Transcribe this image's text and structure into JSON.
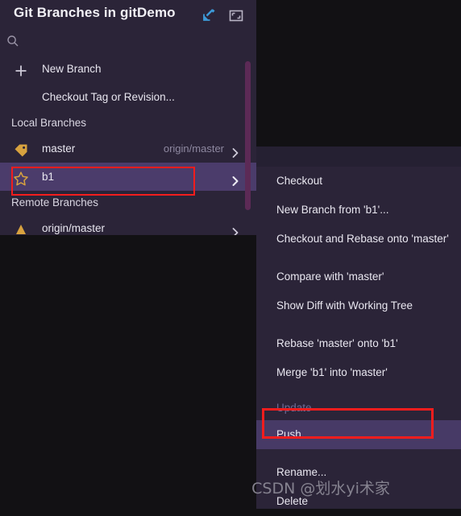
{
  "window": {
    "title": "Git Branches in gitDemo",
    "icons": [
      {
        "name": "open-in-tool-window-icon",
        "label": "Open in Tool Window"
      },
      {
        "name": "restore-window-icon",
        "label": "Restore Window"
      }
    ]
  },
  "search": {
    "value": "",
    "placeholder": "",
    "icon": "search-icon"
  },
  "branch_list": {
    "actions": [
      {
        "label": "New Branch",
        "icon": "plus-icon"
      },
      {
        "label": "Checkout Tag or Revision...",
        "icon": "none"
      }
    ],
    "sections": [
      {
        "header": "Local Branches",
        "rows": [
          {
            "label": "master",
            "icon": "tag-icon",
            "tracking": "origin/master",
            "chevron": "chevron-right-icon",
            "selected": false,
            "annotated": false
          },
          {
            "label": "b1",
            "icon": "star-icon",
            "tracking": "",
            "chevron": "chevron-right-icon",
            "selected": true,
            "annotated": true
          }
        ]
      },
      {
        "header": "Remote Branches",
        "rows": [
          {
            "label": "origin/master",
            "icon": "remote-branch-icon",
            "tracking": "",
            "chevron": "chevron-right-icon",
            "selected": false,
            "annotated": false
          }
        ]
      }
    ]
  },
  "context_menu": {
    "items": [
      {
        "label": "Checkout",
        "type": "item",
        "gap": false,
        "highlighted": false
      },
      {
        "label": "New Branch from 'b1'...",
        "type": "item",
        "gap": false,
        "highlighted": false
      },
      {
        "label": "Checkout and Rebase onto 'master'",
        "type": "item",
        "gap": false,
        "highlighted": false
      },
      {
        "label": "Compare with 'master'",
        "type": "item",
        "gap": true,
        "highlighted": false
      },
      {
        "label": "Show Diff with Working Tree",
        "type": "item",
        "gap": false,
        "highlighted": false
      },
      {
        "label": "Rebase 'master' onto 'b1'",
        "type": "item",
        "gap": true,
        "highlighted": false
      },
      {
        "label": "Merge 'b1' into 'master'",
        "type": "item",
        "gap": false,
        "highlighted": false
      },
      {
        "label": "Update",
        "type": "section-label",
        "gap": true,
        "highlighted": false
      },
      {
        "label": "Push...",
        "type": "item",
        "gap": false,
        "highlighted": true
      },
      {
        "label": "Rename...",
        "type": "item",
        "gap": true,
        "highlighted": false
      },
      {
        "label": "Delete",
        "type": "item",
        "gap": false,
        "highlighted": false
      }
    ]
  },
  "watermark": {
    "text": "CSDN @划水yi术家"
  },
  "colors": {
    "panel_bg": "#2b2438",
    "menu_bg": "#2b2438",
    "selection": "#4b3c6b",
    "highlight": "#473a66",
    "annotation_red": "#f41d1d",
    "scrollbar": "#5c2a56",
    "accent_gold": "#d8a23f",
    "muted_text": "#8e88a0",
    "disabled_label": "#6e6a96",
    "backdrop": "#121114"
  }
}
